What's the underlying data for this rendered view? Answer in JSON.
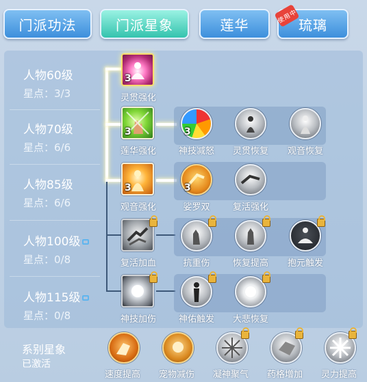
{
  "tabs": [
    {
      "label": "门派功法"
    },
    {
      "label": "门派星象"
    },
    {
      "label": "莲华"
    },
    {
      "label": "琉璃",
      "badge": "使用中"
    }
  ],
  "levels": [
    {
      "label": "人物60级",
      "stars": "星点：3/3",
      "locked": false
    },
    {
      "label": "人物70级",
      "stars": "星点：6/6",
      "locked": false
    },
    {
      "label": "人物85级",
      "stars": "星点：6/6",
      "locked": false
    },
    {
      "label": "人物100级",
      "stars": "星点：0/8",
      "locked": true
    },
    {
      "label": "人物115级",
      "stars": "星点：0/8",
      "locked": true
    }
  ],
  "main_skills": [
    {
      "name": "灵贯强化",
      "level": "3"
    },
    {
      "name": "莲华强化",
      "level": "3"
    },
    {
      "name": "观音强化",
      "level": "3"
    },
    {
      "name": "复活加血",
      "level": ""
    },
    {
      "name": "神技加伤",
      "level": ""
    }
  ],
  "sub_skills": {
    "row70": [
      {
        "name": "神技减怒",
        "level": "3"
      },
      {
        "name": "灵贯恢复",
        "level": ""
      },
      {
        "name": "观音恢复",
        "level": ""
      }
    ],
    "row85": [
      {
        "name": "娑罗双",
        "level": "3"
      },
      {
        "name": "复活强化",
        "level": ""
      }
    ],
    "row100": [
      {
        "name": "抗重伤",
        "level": ""
      },
      {
        "name": "恢复提高",
        "level": ""
      },
      {
        "name": "抱元触发",
        "level": ""
      }
    ],
    "row115": [
      {
        "name": "神佑触发",
        "level": ""
      },
      {
        "name": "大悲恢复",
        "level": ""
      }
    ]
  },
  "series": {
    "title": "系别星象",
    "status": "已激活",
    "skills": [
      {
        "name": "速度提高"
      },
      {
        "name": "宠物减伤"
      },
      {
        "name": "凝神聚气"
      },
      {
        "name": "药格增加"
      },
      {
        "name": "灵力提高"
      }
    ]
  },
  "colors": {
    "tab_blue": "#3d8fdc",
    "tab_active": "#34c3ae",
    "panel": "#9cb9d8",
    "link_glow": "#ffffff",
    "link_dim": "#3d5879",
    "lock": "#e9b43c"
  }
}
